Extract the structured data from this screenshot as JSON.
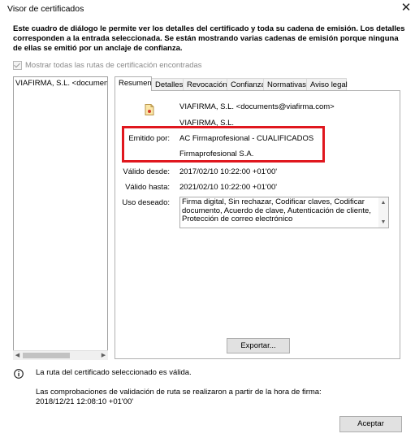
{
  "window": {
    "title": "Visor de certificados"
  },
  "description": "Este cuadro de diálogo le permite ver los detalles del certificado y toda su cadena de emisión. Los detalles corresponden a la entrada seleccionada. Se están mostrando varias cadenas de emisión porque ninguna de ellas se emitió por un anclaje de confianza.",
  "show_all_paths": {
    "label": "Mostrar todas las rutas de certificación encontradas",
    "checked": true,
    "enabled": false
  },
  "tree": {
    "items": [
      "VIAFIRMA, S.L. <documents@viafirma.com>"
    ]
  },
  "tabs": [
    "Resumen",
    "Detalles",
    "Revocación",
    "Confianza",
    "Normativas",
    "Aviso legal"
  ],
  "active_tab": "Resumen",
  "summary": {
    "subject_email": "VIAFIRMA, S.L. <documents@viafirma.com>",
    "subject_org": "VIAFIRMA, S.L.",
    "issued_by_label": "Emitido por:",
    "issued_by_name": "AC Firmaprofesional - CUALIFICADOS",
    "issued_by_org": "Firmaprofesional S.A.",
    "valid_from_label": "Válido desde:",
    "valid_from": "2017/02/10 10:22:00 +01'00'",
    "valid_to_label": "Válido hasta:",
    "valid_to": "2021/02/10 10:22:00 +01'00'",
    "usage_label": "Uso deseado:",
    "usage_value": "Firma digital, Sin rechazar, Codificar claves, Codificar documento, Acuerdo de clave, Autenticación de cliente, Protección de correo electrónico"
  },
  "buttons": {
    "export": "Exportar...",
    "accept": "Aceptar"
  },
  "status": {
    "path_valid": "La ruta del certificado seleccionado es válida.",
    "validation_note": "Las comprobaciones de validación de ruta se realizaron a partir de la hora de firma:",
    "validation_time": "2018/12/21 12:08:10 +01'00'"
  },
  "colors": {
    "highlight": "#e0171e",
    "background": "#ffffff"
  }
}
